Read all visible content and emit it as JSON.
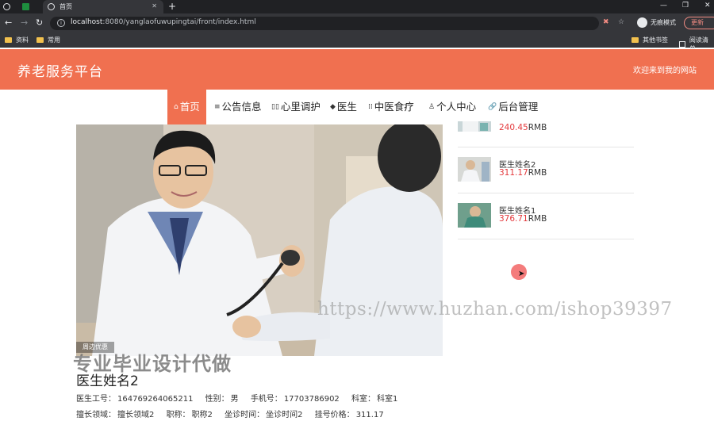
{
  "browser": {
    "tabs": [
      {
        "title": "首页"
      }
    ],
    "url_host": "localhost",
    "url_path": ":8080/yanglaofuwupingtai/front/index.html",
    "incognito_label": "无痕模式",
    "update_label": "更新",
    "bookmarks": [
      "资料",
      "常用",
      "其他书签",
      "阅读清单"
    ]
  },
  "site": {
    "title": "养老服务平台",
    "welcome": "欢迎来到我的网站",
    "brand_color": "#f07050",
    "price_color": "#e4393c"
  },
  "nav": [
    {
      "label": "首页",
      "icon": "home-icon",
      "active": true
    },
    {
      "label": "公告信息",
      "icon": "list-icon"
    },
    {
      "label": "心里调护",
      "icon": "book-icon"
    },
    {
      "label": "医生",
      "icon": "hat-icon"
    },
    {
      "label": "中医食疗",
      "icon": "grid-icon"
    },
    {
      "label": "个人中心",
      "icon": "user-icon"
    },
    {
      "label": "后台管理",
      "icon": "link-icon"
    }
  ],
  "hero": {
    "badge": "周边优惠"
  },
  "doctors": [
    {
      "name": "",
      "price": "240.45",
      "unit": "RMB"
    },
    {
      "name": "医生姓名2",
      "price": "311.17",
      "unit": "RMB"
    },
    {
      "name": "医生姓名1",
      "price": "376.71",
      "unit": "RMB"
    }
  ],
  "watermark": {
    "url": "https://www.huzhan.com/ishop39397",
    "text": "专业毕业设计代做"
  },
  "detail": {
    "title": "医生姓名2",
    "line1": [
      {
        "label": "医生工号：",
        "value": "164769264065211"
      },
      {
        "label": "性别：",
        "value": "男"
      },
      {
        "label": "手机号：",
        "value": "17703786902"
      },
      {
        "label": "科室：",
        "value": "科室1"
      }
    ],
    "line2": [
      {
        "label": "擅长领域：",
        "value": "擅长领域2"
      },
      {
        "label": "职称：",
        "value": "职称2"
      },
      {
        "label": "坐诊时间：",
        "value": "坐诊时间2"
      },
      {
        "label": "挂号价格：",
        "value": "311.17"
      }
    ]
  }
}
